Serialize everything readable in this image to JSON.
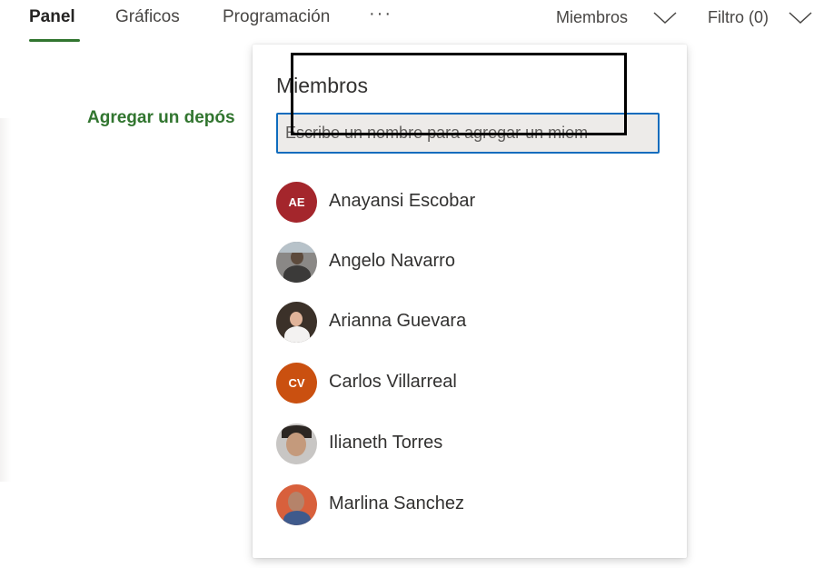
{
  "nav": {
    "tabs": [
      {
        "label": "Panel",
        "active": true
      },
      {
        "label": "Gráficos",
        "active": false
      },
      {
        "label": "Programación",
        "active": false
      }
    ],
    "more_label": "···",
    "members_dropdown": "Miembros",
    "filter_dropdown": "Filtro (0)"
  },
  "board": {
    "add_bucket_label": "Agregar un depós"
  },
  "members_popup": {
    "title": "Miembros",
    "search_placeholder": "Escribe un nombre para agregar un miem",
    "members": [
      {
        "name": "Anayansi Escobar",
        "initials": "AE",
        "avatar_color": "#a4262c",
        "avatar_type": "initials"
      },
      {
        "name": "Angelo Navarro",
        "initials": "",
        "avatar_type": "photo"
      },
      {
        "name": "Arianna Guevara",
        "initials": "",
        "avatar_type": "photo"
      },
      {
        "name": "Carlos Villarreal",
        "initials": "CV",
        "avatar_color": "#ca5010",
        "avatar_type": "initials"
      },
      {
        "name": "Ilianeth Torres",
        "initials": "",
        "avatar_type": "photo"
      },
      {
        "name": "Marlina Sanchez",
        "initials": "",
        "avatar_type": "photo"
      }
    ]
  },
  "colors": {
    "accent_green": "#31752f",
    "input_border": "#0f6cbd"
  }
}
